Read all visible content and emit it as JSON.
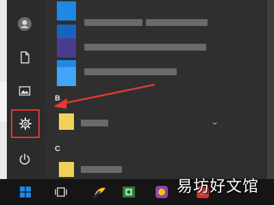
{
  "colors": {
    "menu_bg": "#2f2f2f",
    "highlight_red": "#e53935",
    "accent_blue": "#1e88e5",
    "folder_yellow": "#f2d15b"
  },
  "rail": {
    "items": [
      {
        "icon": "user-icon"
      },
      {
        "icon": "document-icon"
      },
      {
        "icon": "pictures-icon"
      },
      {
        "icon": "gear-icon",
        "highlighted": true
      },
      {
        "icon": "power-icon"
      }
    ]
  },
  "app_list": {
    "section_b": "B",
    "section_c": "C"
  },
  "taskbar": {
    "items": [
      "windows-start-icon",
      "task-view-icon",
      "app-icon",
      "app-icon",
      "app-icon",
      "app-icon"
    ]
  },
  "watermark": "易坊好文馆"
}
